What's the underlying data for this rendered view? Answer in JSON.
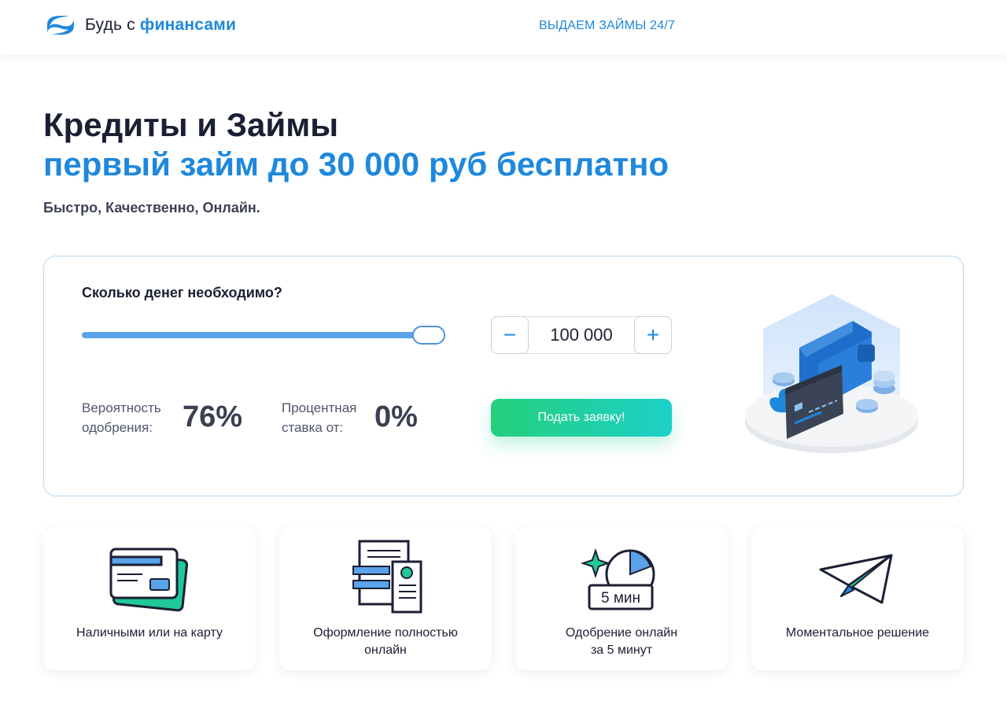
{
  "header": {
    "logo_prefix": "Будь с",
    "logo_accent": "финансами",
    "nav_link": "ВЫДАЕМ ЗАЙМЫ 24/7"
  },
  "hero": {
    "title": "Кредиты и Займы",
    "subtitle": "первый займ до 30 000 руб бесплатно",
    "tagline": "Быстро, Качественно, Онлайн."
  },
  "calculator": {
    "question": "Сколько денег необходимо?",
    "slider_fraction": 0.955,
    "amount": "100 000",
    "minus_symbol": "−",
    "plus_symbol": "+",
    "approval_label": "Вероятность одобрения:",
    "approval_value": "76%",
    "rate_label": "Процентная ставка от:",
    "rate_value": "0%",
    "apply_button": "Подать заявку!"
  },
  "features": [
    {
      "text": "Наличными или на карту",
      "icon": "cards-icon"
    },
    {
      "text": "Оформление полностью\nонлайн",
      "icon": "documents-icon"
    },
    {
      "text": "Одобрение онлайн\nза 5 минут",
      "icon": "timer-icon",
      "icon_label": "5 мин"
    },
    {
      "text": "Моментальное решение",
      "icon": "paper-plane-icon"
    }
  ],
  "colors": {
    "accent": "#1e88dc",
    "dark_text": "#1b1f33",
    "button_gradient_start": "#24d07c",
    "button_gradient_end": "#1dd0c9"
  }
}
